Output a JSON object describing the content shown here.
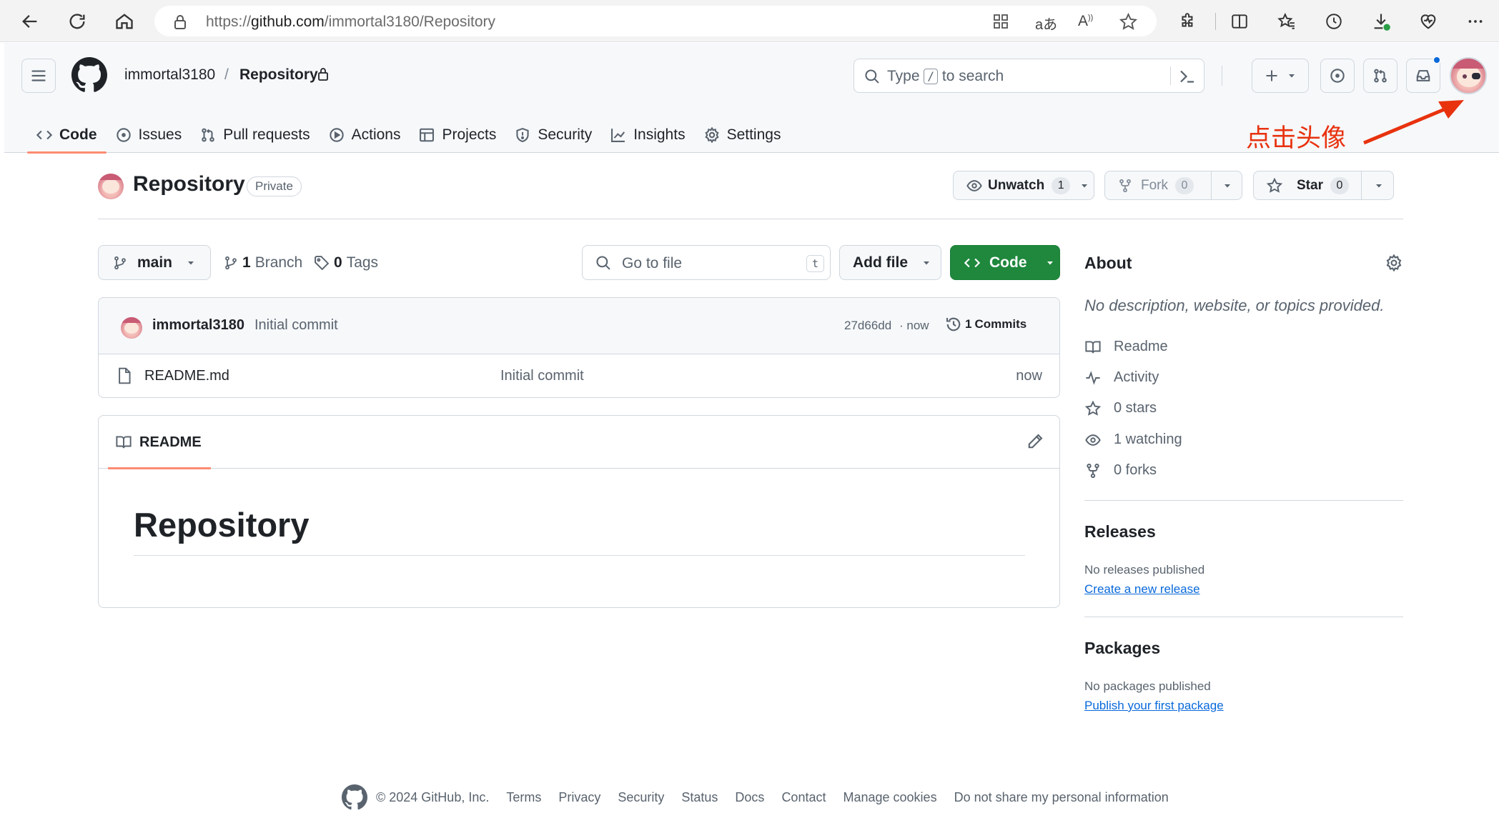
{
  "browser": {
    "url_prefix": "https://",
    "url_domain": "github.com",
    "url_path": "/immortal3180/Repository",
    "icons": [
      "back-icon",
      "refresh-icon",
      "home-icon",
      "lock-icon",
      "apps-icon",
      "translate-icon",
      "read-aloud-icon",
      "favorite-icon",
      "extensions-icon",
      "split-screen-icon",
      "favorites-icon",
      "history-icon",
      "downloads-icon",
      "browser-essentials-icon",
      "more-icon"
    ]
  },
  "header": {
    "owner": "immortal3180",
    "separator": "/",
    "repo": "Repository",
    "search_prefix": "Type",
    "search_key": "/",
    "search_suffix": "to search"
  },
  "nav": {
    "tabs": [
      {
        "label": "Code",
        "icon": "code-icon",
        "active": true
      },
      {
        "label": "Issues",
        "icon": "issue-icon"
      },
      {
        "label": "Pull requests",
        "icon": "pull-request-icon"
      },
      {
        "label": "Actions",
        "icon": "play-icon"
      },
      {
        "label": "Projects",
        "icon": "table-icon"
      },
      {
        "label": "Security",
        "icon": "shield-icon"
      },
      {
        "label": "Insights",
        "icon": "graph-icon"
      },
      {
        "label": "Settings",
        "icon": "gear-icon"
      }
    ]
  },
  "annotation": {
    "text": "点击头像",
    "color": "#e8320e"
  },
  "repo_header": {
    "name": "Repository",
    "visibility": "Private",
    "unwatch_label": "Unwatch",
    "unwatch_count": "1",
    "fork_label": "Fork",
    "fork_count": "0",
    "star_label": "Star",
    "star_count": "0"
  },
  "file_nav": {
    "branch": "main",
    "branches_count": "1",
    "branches_label": "Branch",
    "tags_count": "0",
    "tags_label": "Tags",
    "goto_placeholder": "Go to file",
    "goto_key": "t",
    "add_file_label": "Add file",
    "code_label": "Code"
  },
  "latest_commit": {
    "author": "immortal3180",
    "message": "Initial commit",
    "sha": "27d66dd",
    "time": "· now",
    "commits_count": "1",
    "commits_label": "Commits"
  },
  "files": [
    {
      "name": "README.md",
      "message": "Initial commit",
      "time": "now"
    }
  ],
  "readme": {
    "tab_label": "README",
    "heading": "Repository"
  },
  "about": {
    "title": "About",
    "description": "No description, website, or topics provided.",
    "items": [
      {
        "icon": "book-icon",
        "label": "Readme"
      },
      {
        "icon": "pulse-icon",
        "label": "Activity"
      },
      {
        "icon": "star-icon",
        "label": "0 stars"
      },
      {
        "icon": "eye-icon",
        "label": "1 watching"
      },
      {
        "icon": "fork-icon",
        "label": "0 forks"
      }
    ]
  },
  "releases": {
    "title": "Releases",
    "empty_text": "No releases published",
    "link": "Create a new release"
  },
  "packages": {
    "title": "Packages",
    "empty_text": "No packages published",
    "link": "Publish your first package"
  },
  "footer": {
    "copyright": "© 2024 GitHub, Inc.",
    "links": [
      "Terms",
      "Privacy",
      "Security",
      "Status",
      "Docs",
      "Contact",
      "Manage cookies",
      "Do not share my personal information"
    ]
  },
  "colors": {
    "primary_button": "#1f883d",
    "link": "#0969da",
    "active_tab_underline": "#fd8c73",
    "notification_dot": "#0969da"
  }
}
